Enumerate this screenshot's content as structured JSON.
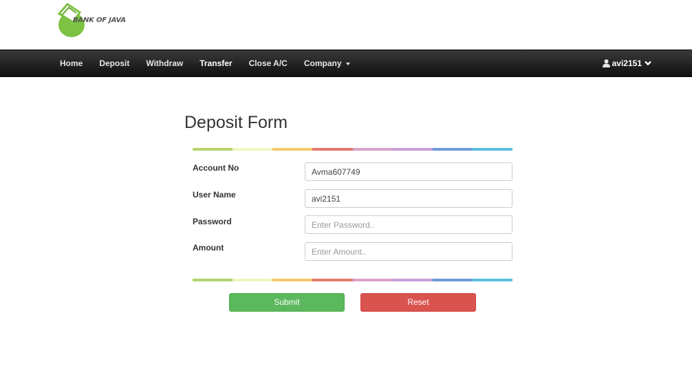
{
  "logo": {
    "text": "BANK OF JAVA",
    "brand_color": "#7dc242"
  },
  "nav": {
    "items": [
      {
        "label": "Home"
      },
      {
        "label": "Deposit"
      },
      {
        "label": "Withdraw"
      },
      {
        "label": "Transfer",
        "active": true
      },
      {
        "label": "Close A/C"
      },
      {
        "label": "Company"
      }
    ],
    "user": {
      "label": "avi2151",
      "icon": "user-icon"
    }
  },
  "form": {
    "title": "Deposit Form",
    "stripe_colors": [
      "#b5d56a",
      "#f0f5c0",
      "#f5c76a",
      "#e6786e",
      "#d9a3c9",
      "#c7a0d8",
      "#6b9bd8",
      "#5bc0de"
    ],
    "fields": [
      {
        "label": "Account No",
        "value": "Avma607749",
        "placeholder": ""
      },
      {
        "label": "User Name",
        "value": "avi2151",
        "placeholder": ""
      },
      {
        "label": "Password",
        "value": "",
        "placeholder": "Enter Password.."
      },
      {
        "label": "Amount",
        "value": "",
        "placeholder": "Enter Amount.."
      }
    ],
    "submit_label": "Submit",
    "reset_label": "Reset",
    "submit_color": "#5cb85c",
    "reset_color": "#d9534f"
  }
}
